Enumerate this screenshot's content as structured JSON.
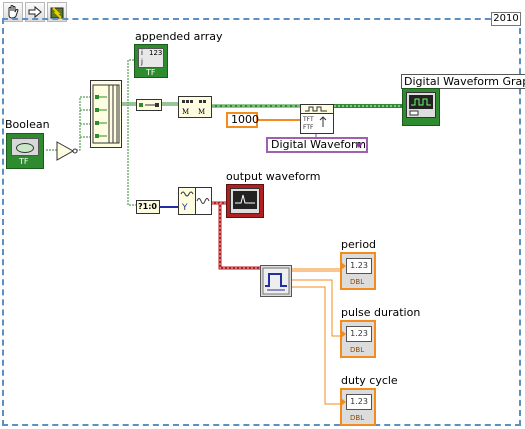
{
  "toolbar": {
    "items": [
      {
        "name": "run-continuously",
        "icon": "hand-icon"
      },
      {
        "name": "abort",
        "icon": "arrow-icon"
      },
      {
        "name": "highlight",
        "icon": "bulb-icon"
      }
    ]
  },
  "diagram": {
    "year_label": "2010",
    "boolean_label": "Boolean",
    "appended_array_label": "appended array",
    "graph_label": "Digital Waveform Graph",
    "constant_value": "1000",
    "ring_value": "Digital Waveform",
    "output_waveform_label": "output waveform",
    "period_label": "period",
    "pulse_duration_label": "pulse duration",
    "duty_cycle_label": "duty cycle",
    "numeric_display": "1.23",
    "dbl_tag": "DBL",
    "tf_tag": "TF",
    "convert_text": "?1:0",
    "colors": {
      "boolean_wire": "#2f8b2f",
      "numeric_wire": "#f28c1e",
      "waveform_wire": "#b02020",
      "frame": "#5d8fc2"
    }
  }
}
